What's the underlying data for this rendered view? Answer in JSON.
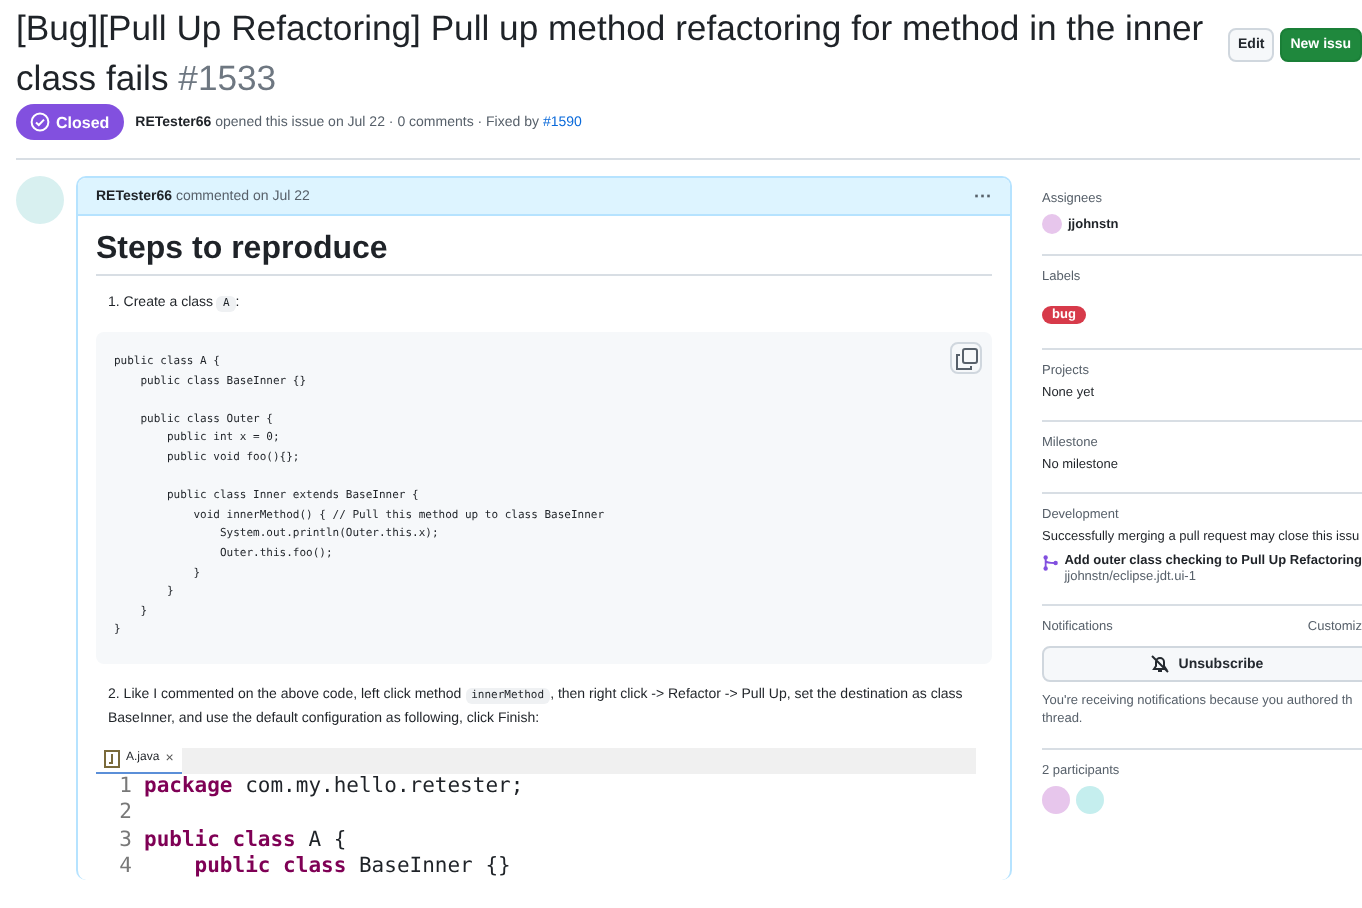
{
  "issue": {
    "title": "[Bug][Pull Up Refactoring] Pull up method refactoring for method in the inner class fails",
    "number": "#1533",
    "state": "Closed",
    "author": "RETester66",
    "meta": "opened this issue on Jul 22 · 0 comments · Fixed by",
    "fixed_by": "#1590"
  },
  "header_buttons": [
    {
      "label": "Edit",
      "kind": "default"
    },
    {
      "label": "New issu",
      "kind": "primary"
    }
  ],
  "comment": {
    "author": "RETester66",
    "when": "commented on Jul 22",
    "menu": "···",
    "heading": "Steps to reproduce",
    "steps": [
      {
        "number": "1.",
        "parts": [
          {
            "kind": "text",
            "text": "Create a class "
          },
          {
            "kind": "code",
            "text": "A"
          },
          {
            "kind": "text",
            "text": ":"
          }
        ]
      },
      {
        "number": "2.",
        "parts": [
          {
            "kind": "text",
            "text": "Like I commented on the above code, left click method "
          },
          {
            "kind": "code",
            "text": "innerMethod"
          },
          {
            "kind": "text",
            "text": ", then right click -> Refactor -> Pull Up, set the destination as class BaseInner, and use the default configuration as following, click Finish:"
          }
        ]
      }
    ],
    "code": [
      {
        "text": "public class A {"
      },
      {
        "text": "    public class BaseInner {}"
      },
      {
        "text": "    public class Outer {",
        "blank_before": true
      },
      {
        "text": "        public int x = 0;"
      },
      {
        "text": "        public void foo(){};"
      },
      {
        "text": "        public class Inner extends BaseInner {",
        "blank_before": true
      },
      {
        "text": "            void innerMethod() { // Pull this method up to class BaseInner"
      },
      {
        "text": "                System.out.println(Outer.this.x);"
      },
      {
        "text": "                Outer.this.foo();"
      },
      {
        "text": "            }"
      },
      {
        "text": "        }"
      },
      {
        "text": "    }"
      },
      {
        "text": "}"
      }
    ],
    "editor": {
      "tab": "A.java",
      "close": "×",
      "lines": [
        {
          "number": "1",
          "tokens": [
            {
              "kind": "keyword",
              "text": "package"
            },
            {
              "kind": "plain",
              "text": "com.my.hello.retester;"
            }
          ]
        },
        {
          "number": "2"
        },
        {
          "number": "3",
          "tokens": [
            {
              "kind": "keyword",
              "text": "public"
            },
            {
              "kind": "keyword",
              "text": "class"
            },
            {
              "kind": "plain",
              "text": "A {"
            }
          ]
        },
        {
          "number": "4",
          "indented": true,
          "tokens": [
            {
              "kind": "keyword",
              "text": "public"
            },
            {
              "kind": "keyword",
              "text": "class"
            },
            {
              "kind": "plain",
              "text": "BaseInner {}"
            }
          ]
        }
      ]
    }
  },
  "sidebar": {
    "assignees": {
      "heading": "Assignees",
      "users": [
        "jjohnstn"
      ]
    },
    "labels": {
      "heading": "Labels",
      "items": [
        {
          "name": "bug",
          "color": "#d73a4a"
        }
      ]
    },
    "projects": {
      "heading": "Projects",
      "value": "None yet"
    },
    "milestone": {
      "heading": "Milestone",
      "value": "No milestone"
    },
    "development": {
      "heading": "Development",
      "note": "Successfully merging a pull request may close this issu",
      "pr_title": "Add outer class checking to Pull Up Refactoring",
      "pr_repo": "jjohnstn/eclipse.jdt.ui-1"
    },
    "notifications": {
      "heading": "Notifications",
      "customize": "Customiz",
      "button": "Unsubscribe",
      "note": "You're receiving notifications because you authored th",
      "note2": "thread."
    },
    "participants": {
      "heading": "2 participants",
      "avatars": [
        {
          "color": "#e7c6ec"
        },
        {
          "color": "#c5eeee"
        }
      ]
    }
  }
}
